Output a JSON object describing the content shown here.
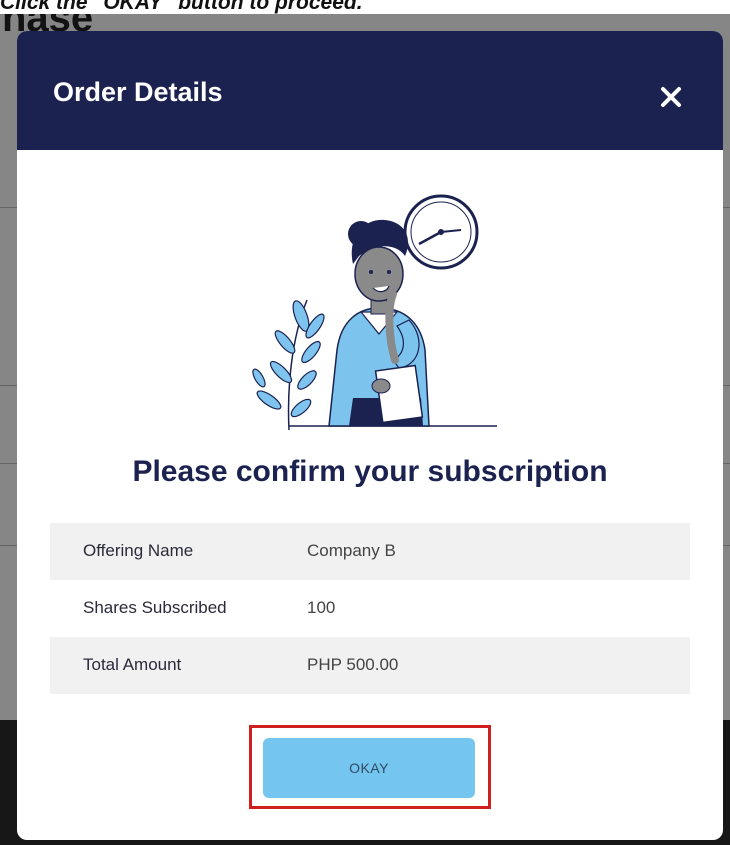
{
  "instruction": "Click the \"OKAY\" button to proceed.",
  "background": {
    "heading": "nase"
  },
  "modal": {
    "title": "Order Details",
    "close_symbol": "✕",
    "confirm_heading": "Please confirm your subscription",
    "details": [
      {
        "label": "Offering Name",
        "value": "Company B"
      },
      {
        "label": "Shares Subscribed",
        "value": "100"
      },
      {
        "label": "Total Amount",
        "value": "PHP 500.00"
      }
    ],
    "okay_label": "OKAY"
  },
  "colors": {
    "header": "#1b2250",
    "okay_button": "#74c6f0",
    "highlight": "#d01f1f",
    "shirt": "#7cc3ee",
    "leaves": "#7fc4ee"
  },
  "icons": {
    "close": "close-icon",
    "clock": "clock-icon"
  }
}
